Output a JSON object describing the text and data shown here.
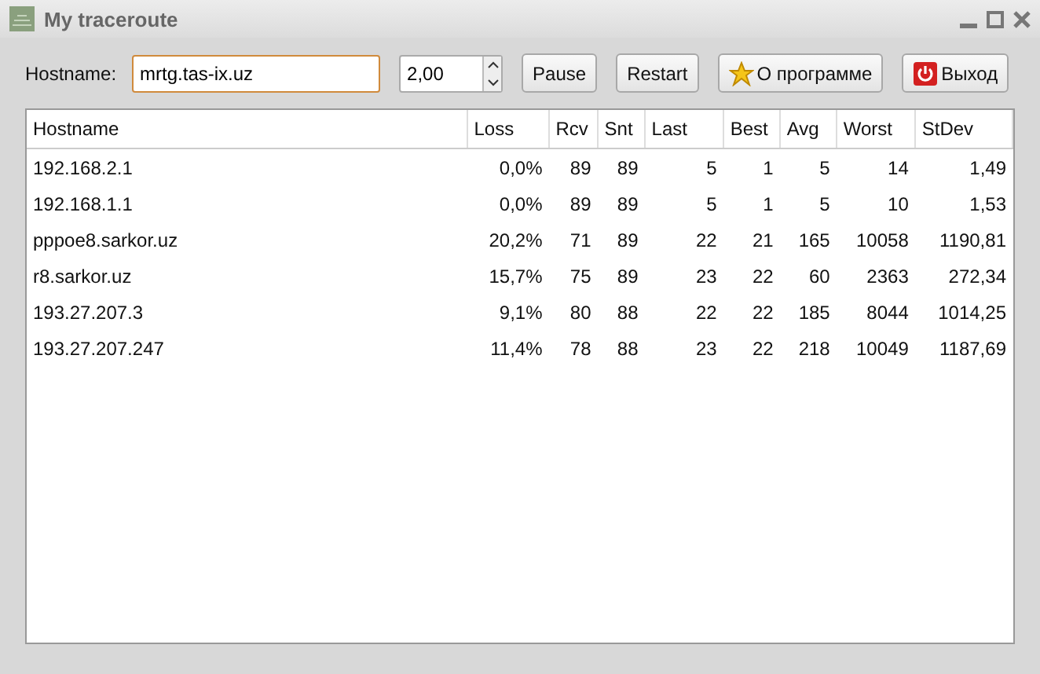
{
  "window": {
    "title": "My traceroute"
  },
  "toolbar": {
    "hostname_label": "Hostname:",
    "hostname": "mrtg.tas-ix.uz",
    "interval": "2,00",
    "buttons": [
      {
        "kind": "plain",
        "label": "Pause"
      },
      {
        "kind": "plain",
        "label": "Restart"
      },
      {
        "kind": "about",
        "label": "О программе"
      },
      {
        "kind": "exit",
        "label": "Выход"
      }
    ]
  },
  "table": {
    "columns": [
      "Hostname",
      "Loss",
      "Rcv",
      "Snt",
      "Last",
      "Best",
      "Avg",
      "Worst",
      "StDev"
    ],
    "rows": [
      [
        "192.168.2.1",
        "0,0%",
        "89",
        "89",
        "5",
        "1",
        "5",
        "14",
        "1,49"
      ],
      [
        "192.168.1.1",
        "0,0%",
        "89",
        "89",
        "5",
        "1",
        "5",
        "10",
        "1,53"
      ],
      [
        "pppoe8.sarkor.uz",
        "20,2%",
        "71",
        "89",
        "22",
        "21",
        "165",
        "10058",
        "1190,81"
      ],
      [
        "r8.sarkor.uz",
        "15,7%",
        "75",
        "89",
        "23",
        "22",
        "60",
        "2363",
        "272,34"
      ],
      [
        "193.27.207.3",
        "9,1%",
        "80",
        "88",
        "22",
        "22",
        "185",
        "8044",
        "1014,25"
      ],
      [
        "193.27.207.247",
        "11,4%",
        "78",
        "88",
        "23",
        "22",
        "218",
        "10049",
        "1187,69"
      ]
    ]
  }
}
